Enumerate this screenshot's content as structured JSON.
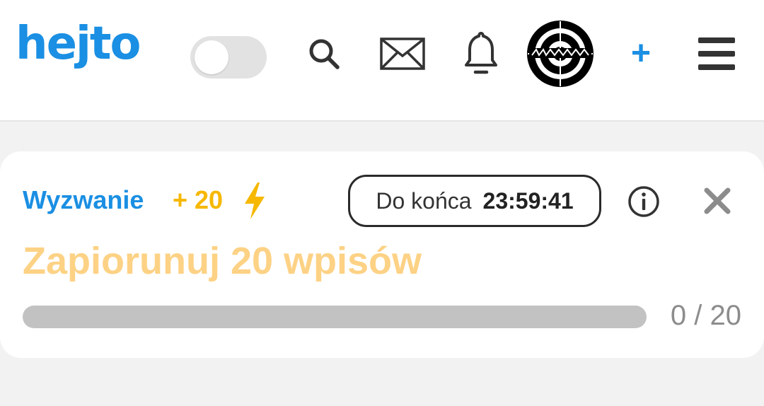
{
  "header": {
    "logo_text": "hejto",
    "theme_toggle": {
      "on": false
    },
    "icons": {
      "search": "search-icon",
      "messages": "mail-icon",
      "notifications": "bell-icon",
      "avatar": "user-avatar",
      "add": "plus-icon",
      "menu": "hamburger-menu-icon"
    },
    "add_label": "+",
    "accent_color": "#1a8fe3"
  },
  "challenge": {
    "label": "Wyzwanie",
    "points": "+ 20",
    "timer_label": "Do końca",
    "timer_value": "23:59:41",
    "title": "Zapiorunuj 20 wpisów",
    "progress_text": "0 / 20",
    "progress_current": 0,
    "progress_total": 20,
    "points_color": "#f6b800",
    "title_color": "#fdd285"
  }
}
